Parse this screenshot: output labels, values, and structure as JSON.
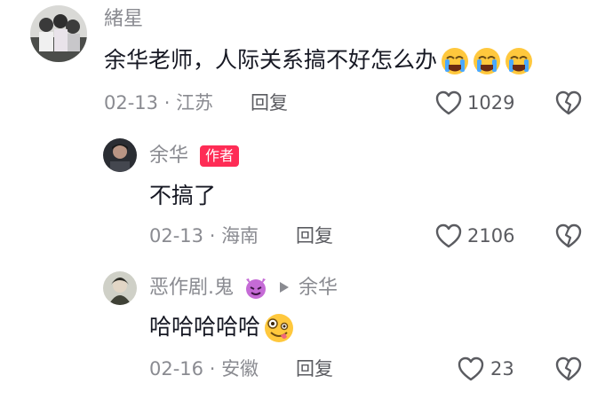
{
  "comments": [
    {
      "author": "緒星",
      "text": "余华老师，人际关系搞不好怎么办",
      "emoji_names": [
        "loudly-crying-face",
        "loudly-crying-face",
        "loudly-crying-face"
      ],
      "date": "02-13",
      "location": "江苏",
      "reply_label": "回复",
      "likes": "1029"
    },
    {
      "author": "余华",
      "badge": "作者",
      "text": "不搞了",
      "date": "02-13",
      "location": "海南",
      "reply_label": "回复",
      "likes": "2106"
    },
    {
      "author": "恶作剧.鬼",
      "author_emoji": "smiling-imp-face",
      "reply_to": "余华",
      "text": "哈哈哈哈哈",
      "emoji_names": [
        "zany-face"
      ],
      "date": "02-16",
      "location": "安徽",
      "reply_label": "回复",
      "likes": "23"
    }
  ],
  "separator": " · ",
  "colors": {
    "badge": "#fe2c55",
    "meta": "#8a8b91",
    "text": "#161823",
    "imp": "#c56bd6",
    "emoji": "#ffc83d",
    "tear": "#4aa8ff"
  }
}
